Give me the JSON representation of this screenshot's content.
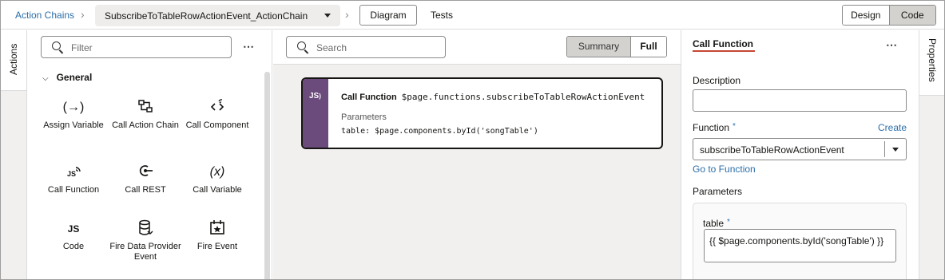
{
  "breadcrumb": {
    "root_label": "Action Chains",
    "current_chain": "SubscribeToTableRowActionEvent_ActionChain"
  },
  "toolbar": {
    "diagram_tab": "Diagram",
    "tests_tab": "Tests",
    "design_label": "Design",
    "code_label": "Code"
  },
  "left_tab": {
    "label": "Actions"
  },
  "palette": {
    "filter_placeholder": "Filter",
    "more_label": "⋯",
    "group_label": "General",
    "items": [
      {
        "label": "Assign Variable",
        "icon": "(→)"
      },
      {
        "label": "Call Action Chain",
        "icon": "chain-icon"
      },
      {
        "label": "Call Component",
        "icon": "component-icon"
      },
      {
        "label": "Call Function",
        "icon": "js-signal-icon"
      },
      {
        "label": "Call REST",
        "icon": "rest-icon"
      },
      {
        "label": "Call Variable",
        "icon": "(x)"
      },
      {
        "label": "Code",
        "icon": "JS"
      },
      {
        "label": "Fire Data Provider Event",
        "icon": "database-icon"
      },
      {
        "label": "Fire Event",
        "icon": "event-icon"
      }
    ]
  },
  "canvas": {
    "search_placeholder": "Search",
    "summary_label": "Summary",
    "full_label": "Full",
    "node": {
      "action_name": "Call Function",
      "function_ref": "$page.functions.subscribeToTableRowActionEvent",
      "params_label": "Parameters",
      "params_value": "table: $page.components.byId('songTable')",
      "icon_text": "JS"
    }
  },
  "properties": {
    "title": "Call Function",
    "more_label": "⋯",
    "description_label": "Description",
    "description_value": "",
    "function_label": "Function",
    "required_mark": "*",
    "create_link": "Create",
    "function_value": "subscribeToTableRowActionEvent",
    "go_to_function_link": "Go to Function",
    "parameters_label": "Parameters",
    "table_label": "table",
    "table_value": "{{ $page.components.byId('songTable') }}"
  },
  "right_tab": {
    "label": "Properties"
  },
  "colors": {
    "accent_link": "#2b6ea8",
    "node_bar": "#6b4a7c",
    "title_underline": "#c74634"
  }
}
